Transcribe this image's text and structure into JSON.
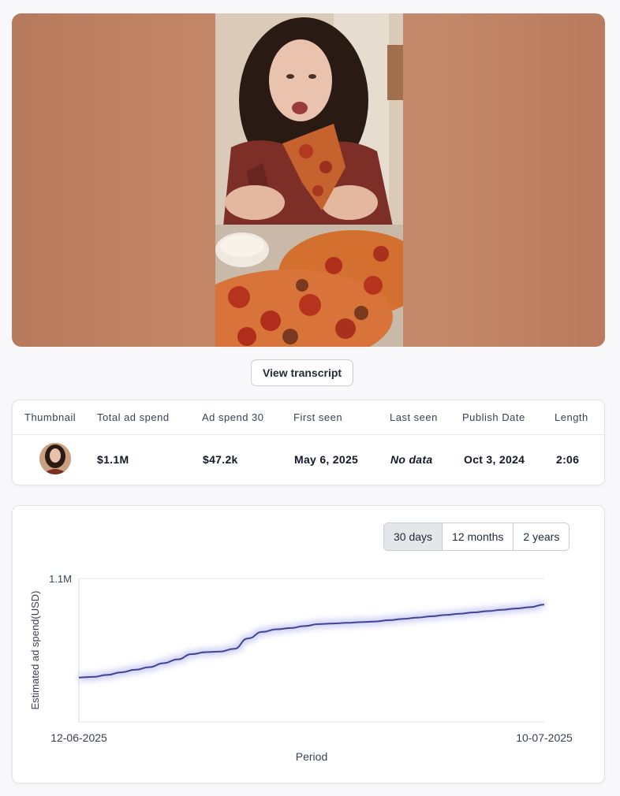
{
  "video": {
    "transcript_button": "View transcript"
  },
  "table": {
    "headers": [
      "Thumbnail",
      "Total ad spend",
      "Ad spend 30",
      "First seen",
      "Last seen",
      "Publish Date",
      "Length"
    ],
    "row": {
      "total_ad_spend": "$1.1M",
      "ad_spend_30": "$47.2k",
      "first_seen": "May 6, 2025",
      "last_seen": "No data",
      "publish_date": "Oct 3, 2024",
      "length": "2:06"
    }
  },
  "range_selector": {
    "options": [
      "30 days",
      "12 months",
      "2 years"
    ],
    "selected": "30 days"
  },
  "chart_data": {
    "type": "line",
    "xlabel": "Period",
    "ylabel": "Estimated ad spend(USD)",
    "x_tick_labels": [
      "12-06-2025",
      "10-07-2025"
    ],
    "y_tick_labels": [
      "1.1M"
    ],
    "ylim": [
      0,
      1100000
    ],
    "grid": true,
    "line_color": "#3f4590",
    "series": [
      {
        "values": [
          340000,
          345000,
          360000,
          380000,
          400000,
          420000,
          450000,
          480000,
          520000,
          535000,
          540000,
          560000,
          640000,
          690000,
          710000,
          720000,
          735000,
          750000,
          755000,
          760000,
          765000,
          770000,
          780000,
          790000,
          800000,
          810000,
          820000,
          830000,
          840000,
          850000,
          860000,
          870000,
          880000,
          900000
        ]
      }
    ]
  }
}
